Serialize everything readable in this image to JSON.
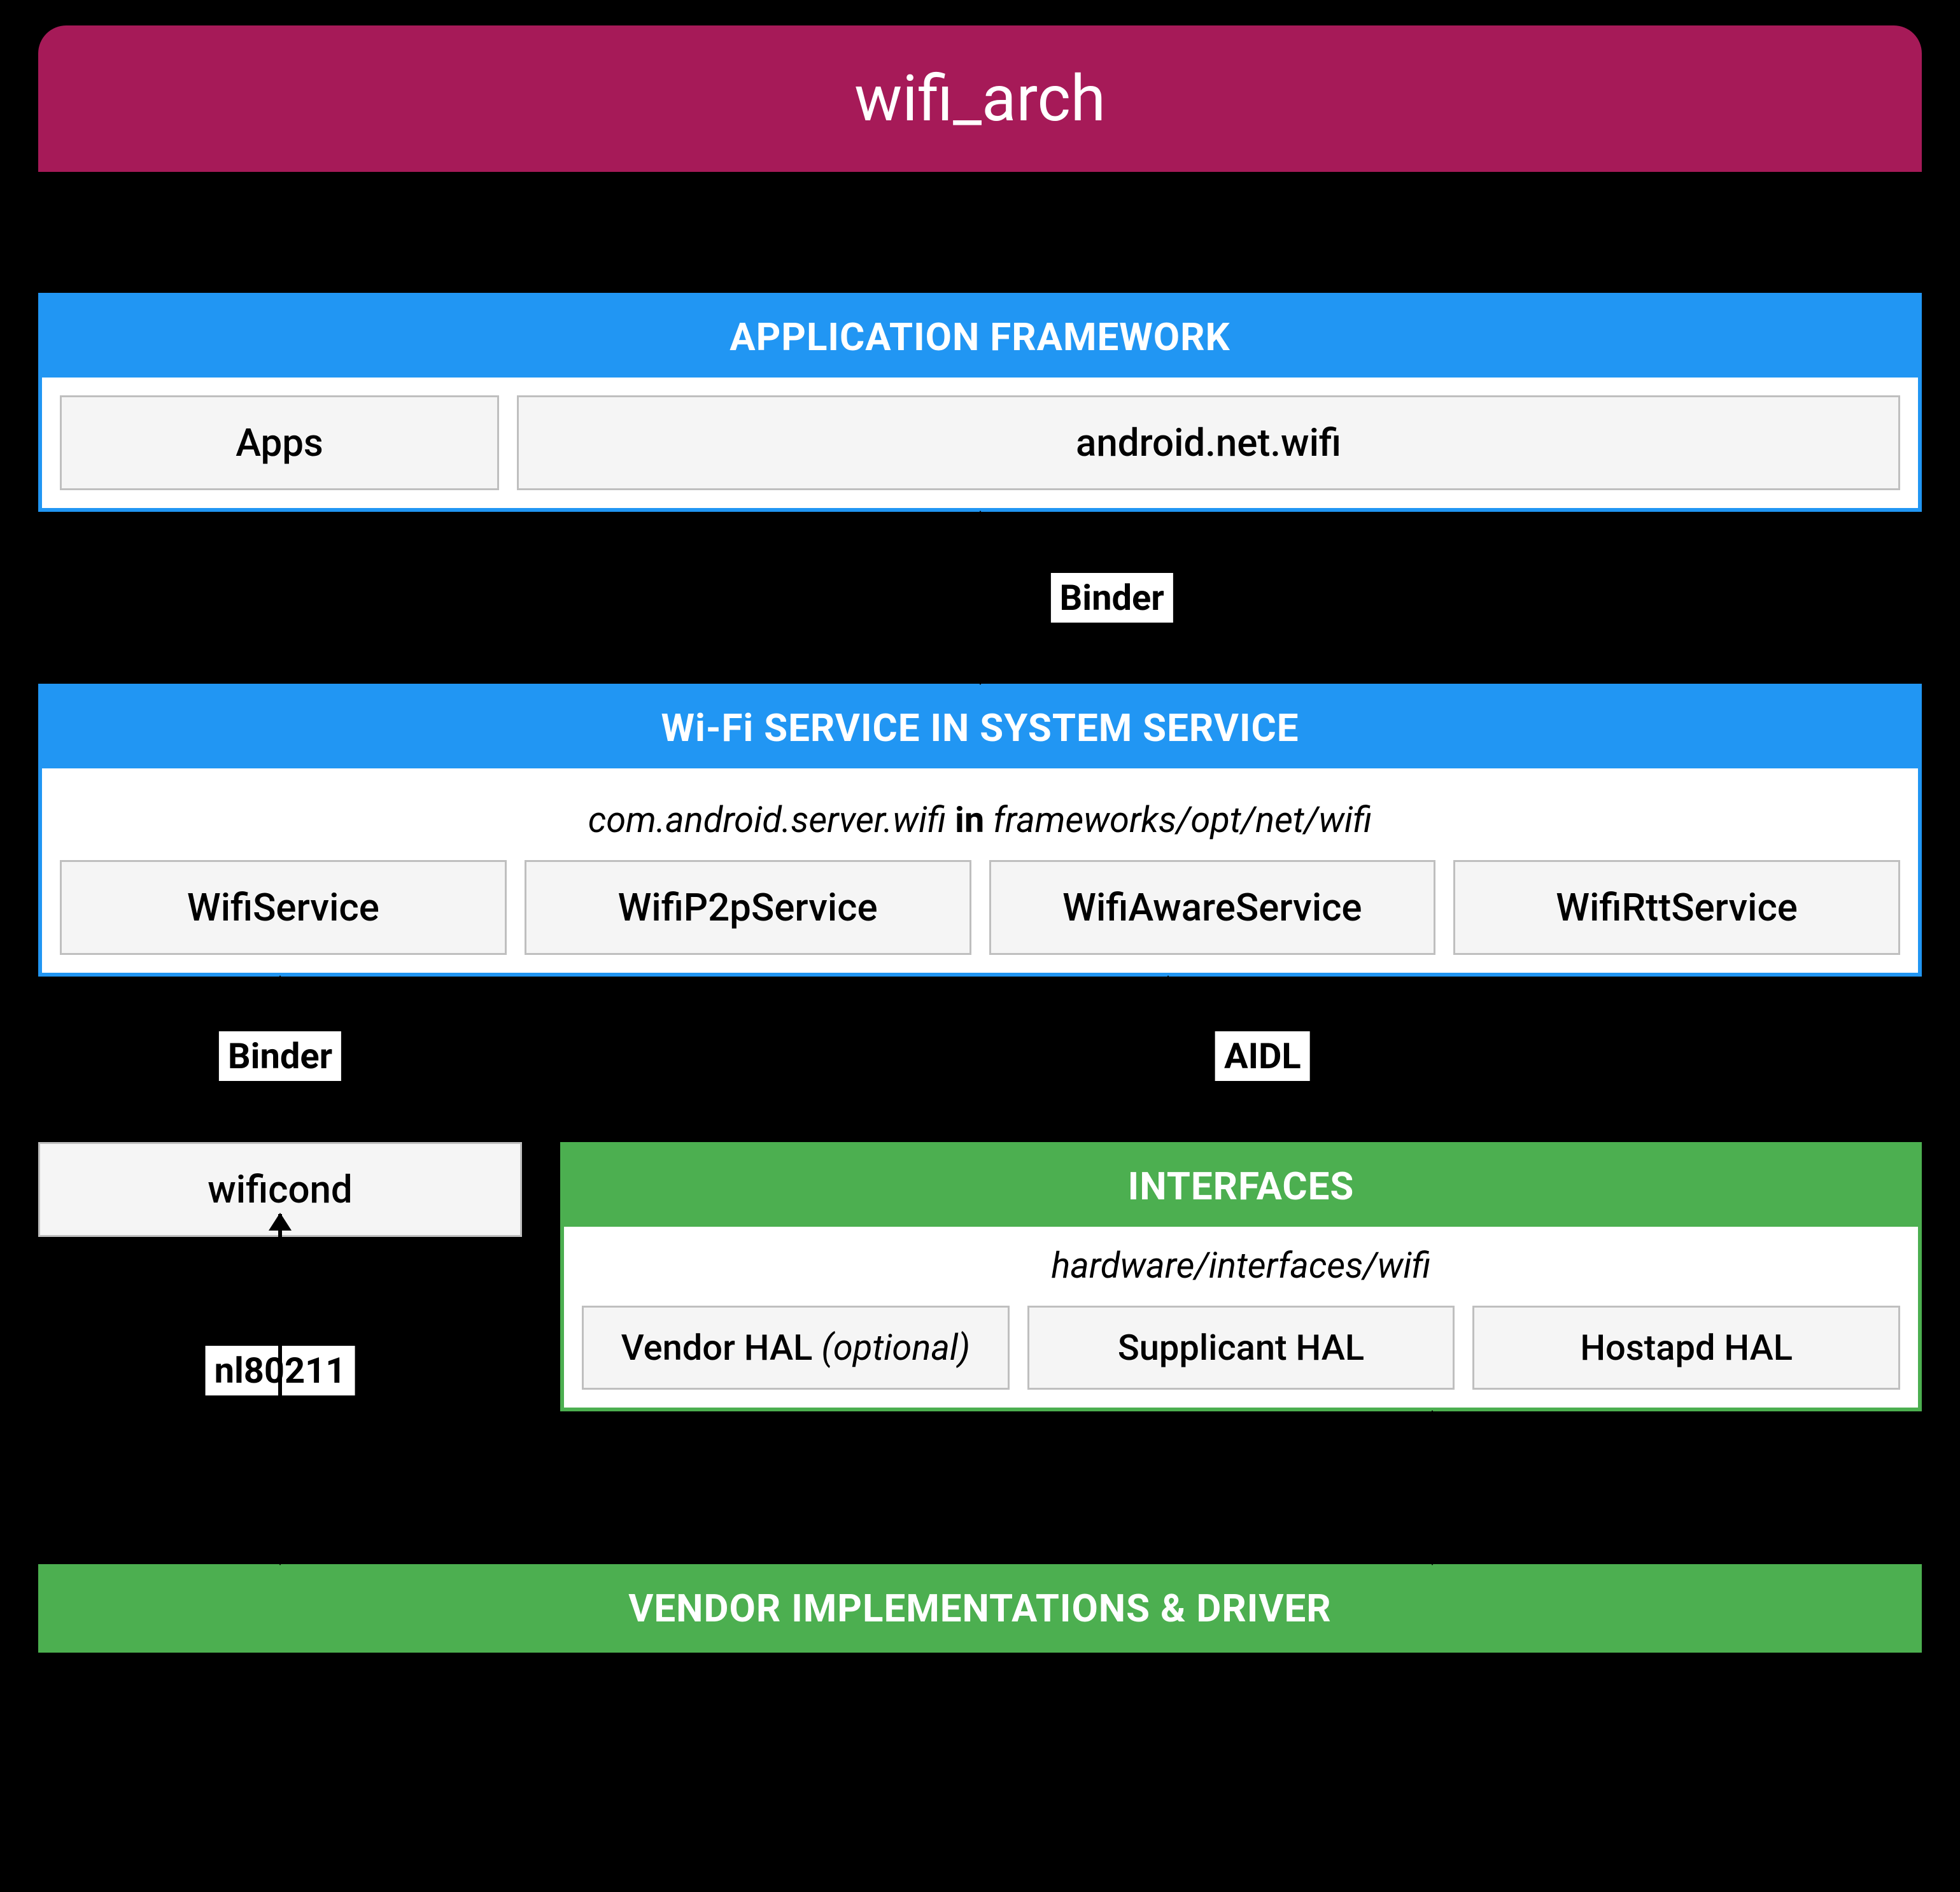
{
  "title": "wifi_arch",
  "app_framework": {
    "header": "APPLICATION FRAMEWORK",
    "apps": "Apps",
    "netwifi": "android.net.wifi"
  },
  "connector1": {
    "label": "Binder"
  },
  "system_service": {
    "header": "Wi-Fi SERVICE IN SYSTEM SERVICE",
    "subtitle_pkg": "com.android.server.wifi",
    "subtitle_in": "in",
    "subtitle_path": "frameworks/opt/net/wifi",
    "services": [
      "WifiService",
      "WifiP2pService",
      "WifiAwareService",
      "WifiRttService"
    ]
  },
  "connector2": {
    "left": "Binder",
    "mid": "AIDL"
  },
  "wificond": "wificond",
  "interfaces": {
    "header": "INTERFACES",
    "subtitle": "hardware/interfaces/wifi",
    "hals_vendor": "Vendor HAL",
    "hals_vendor_opt": "(optional)",
    "hals_supp": "Supplicant HAL",
    "hals_host": "Hostapd HAL"
  },
  "nl_label": "nl80211",
  "vendor_bar": "VENDOR IMPLEMENTATIONS & DRIVER"
}
